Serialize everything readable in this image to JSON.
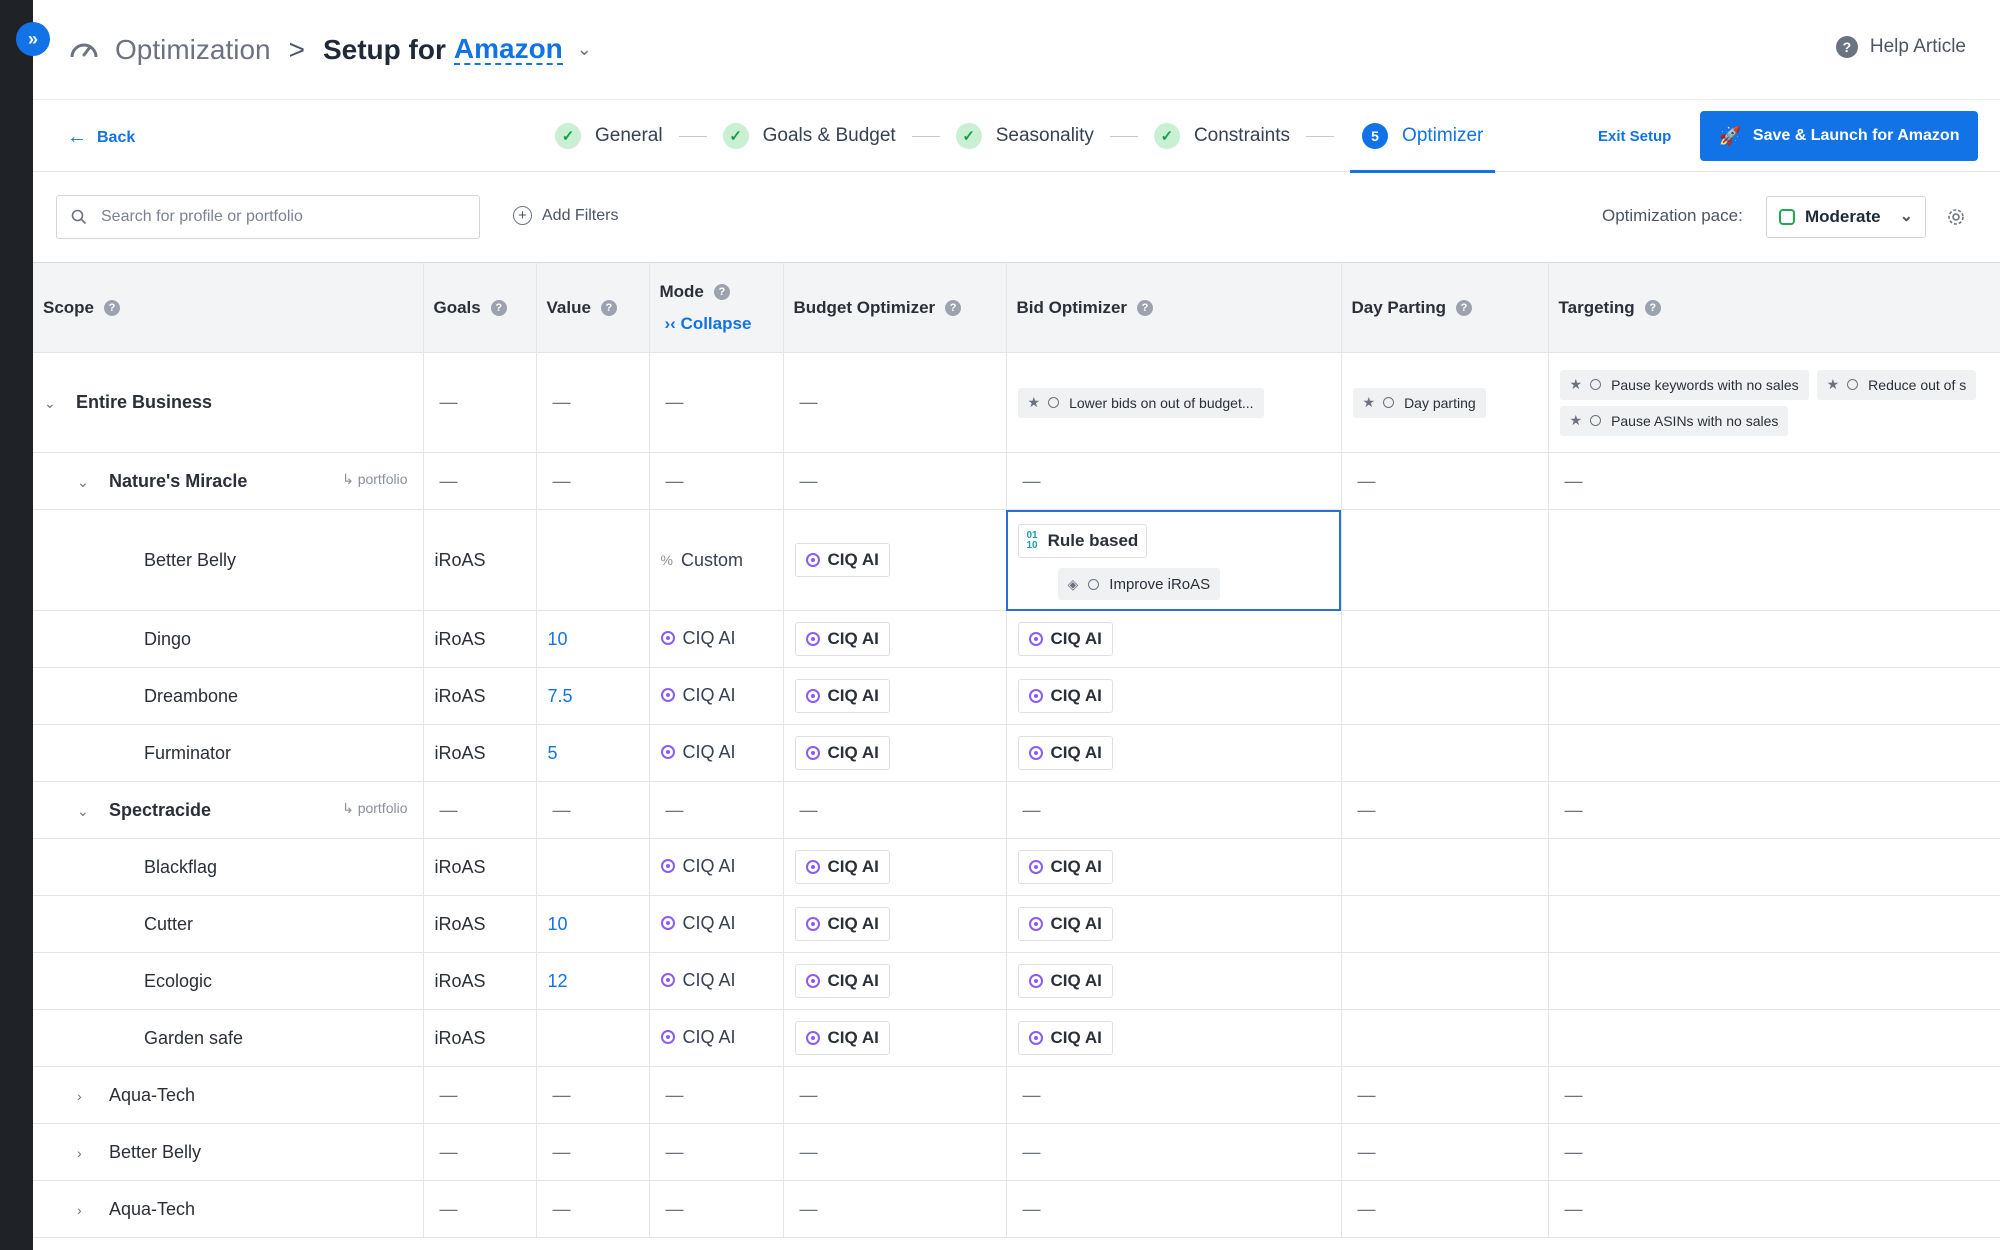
{
  "header": {
    "root_title": "Optimization",
    "separator": ">",
    "setup_prefix": "Setup for",
    "channel": "Amazon",
    "help_label": "Help Article"
  },
  "stepbar": {
    "back_label": "Back",
    "steps": [
      {
        "label": "General",
        "state": "done"
      },
      {
        "label": "Goals & Budget",
        "state": "done"
      },
      {
        "label": "Seasonality",
        "state": "done"
      },
      {
        "label": "Constraints",
        "state": "done"
      },
      {
        "label": "Optimizer",
        "state": "active",
        "number": "5"
      }
    ],
    "exit_label": "Exit Setup",
    "save_label": "Save & Launch for Amazon"
  },
  "filters": {
    "search_placeholder": "Search for profile or portfolio",
    "add_filters_label": "Add Filters",
    "pace_label": "Optimization pace:",
    "pace_value": "Moderate"
  },
  "table": {
    "headers": {
      "scope": "Scope",
      "goals": "Goals",
      "value": "Value",
      "mode": "Mode",
      "collapse": "Collapse",
      "budget": "Budget Optimizer",
      "bid": "Bid Optimizer",
      "dayparting": "Day Parting",
      "targeting": "Targeting"
    },
    "dash": "—",
    "portfolio_label": "portfolio",
    "chip_label": "CIQ AI",
    "entire_business": {
      "label": "Entire Business",
      "bid_tag": "Lower bids on out of budget...",
      "dayparting_tag": "Day parting",
      "targeting_tags": [
        "Pause keywords with no sales",
        "Reduce out of s",
        "Pause ASINs with no sales"
      ]
    },
    "groups": [
      {
        "label": "Nature's Miracle",
        "rows": [
          {
            "name": "Better Belly",
            "goal": "iRoAS",
            "value": "",
            "mode": "Custom",
            "budget": "CIQ AI",
            "bid_rule": "Rule based",
            "bid_sub": "Improve iRoAS"
          },
          {
            "name": "Dingo",
            "goal": "iRoAS",
            "value": "10",
            "mode": "CIQ AI",
            "budget": "CIQ AI",
            "bid": "CIQ AI"
          },
          {
            "name": "Dreambone",
            "goal": "iRoAS",
            "value": "7.5",
            "mode": "CIQ AI",
            "budget": "CIQ AI",
            "bid": "CIQ AI"
          },
          {
            "name": "Furminator",
            "goal": "iRoAS",
            "value": "5",
            "mode": "CIQ AI",
            "budget": "CIQ AI",
            "bid": "CIQ AI"
          }
        ]
      },
      {
        "label": "Spectracide",
        "rows": [
          {
            "name": "Blackflag",
            "goal": "iRoAS",
            "value": "",
            "mode": "CIQ AI",
            "budget": "CIQ AI",
            "bid": "CIQ AI"
          },
          {
            "name": "Cutter",
            "goal": "iRoAS",
            "value": "10",
            "mode": "CIQ AI",
            "budget": "CIQ AI",
            "bid": "CIQ AI"
          },
          {
            "name": "Ecologic",
            "goal": "iRoAS",
            "value": "12",
            "mode": "CIQ AI",
            "budget": "CIQ AI",
            "bid": "CIQ AI"
          },
          {
            "name": "Garden safe",
            "goal": "iRoAS",
            "value": "",
            "mode": "CIQ AI",
            "budget": "CIQ AI",
            "bid": "CIQ AI"
          }
        ]
      }
    ],
    "collapsed_rows": [
      "Aqua-Tech",
      "Better Belly",
      "Aqua-Tech"
    ]
  },
  "colors": {
    "accent": "#1273e6",
    "success": "#1e9e4a",
    "ai_purple": "#8b5cf6",
    "sidebar": "#1f2328"
  }
}
